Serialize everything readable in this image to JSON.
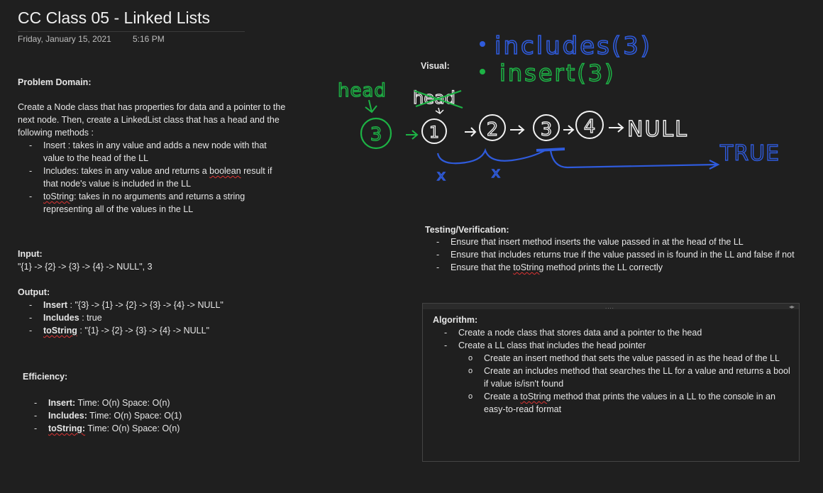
{
  "page": {
    "title": "CC Class 05 - Linked Lists",
    "date": "Friday, January 15, 2021",
    "time": "5:16 PM"
  },
  "problem_domain": {
    "heading": "Problem Domain:",
    "intro": "Create a Node class that has properties for data and a pointer to the next node. Then, create a LinkedList class that has a head and the following methods :",
    "items": [
      {
        "pre": "Insert : takes in any value and adds a new node with that value to the head of the LL"
      },
      {
        "pre": "Includes: takes in any value and returns a ",
        "u": "boolean",
        "post": " result if that node's value is included in the LL"
      },
      {
        "u": "toString",
        "post": ": takes in no arguments and returns a string representing all of the values in the LL"
      }
    ]
  },
  "input": {
    "heading": "Input:",
    "value": "\"{1} -> {2} -> {3} -> {4} -> NULL\", 3"
  },
  "output": {
    "heading": "Output:",
    "items": [
      {
        "label": "Insert",
        "sep": " : ",
        "value": "\"{3} -> {1} -> {2} -> {3} -> {4} -> NULL\""
      },
      {
        "label": "Includes",
        "sep": " : ",
        "value": "true"
      },
      {
        "label": "toString",
        "sep": " : ",
        "value": "\"{1} -> {2} -> {3} -> {4} -> NULL\""
      }
    ]
  },
  "efficiency": {
    "heading": "Efficiency:",
    "items": [
      {
        "label": "Insert:",
        "value": " Time: O(n) Space: O(n)"
      },
      {
        "label": "Includes:",
        "value": " Time: O(n) Space: O(1)"
      },
      {
        "label": "toString:",
        "value": " Time: O(n) Space: O(n)"
      }
    ]
  },
  "visual": {
    "heading": "Visual:",
    "handwriting": {
      "includes": "includes(3)",
      "insert": "insert(3)",
      "head_new": "head",
      "head_old": "head",
      "nodes": [
        "3",
        "1",
        "2",
        "3",
        "4"
      ],
      "null": "NULL",
      "true": "TRUE",
      "marks": [
        "x",
        "x"
      ]
    },
    "colors": {
      "ink_green": "#1db345",
      "ink_blue": "#2f5bdc",
      "ink_white": "#f2f2f2"
    }
  },
  "testing": {
    "heading": "Testing/Verification:",
    "items": [
      {
        "pre": "Ensure that insert method inserts the value passed in at the head of the LL"
      },
      {
        "pre": "Ensure that includes returns true if the value passed in is found in the LL and false if not"
      },
      {
        "pre": "Ensure that the ",
        "u": "toString",
        "post": " method prints the LL correctly"
      }
    ]
  },
  "algorithm": {
    "heading": "Algorithm:",
    "items": [
      {
        "pre": "Create a node class that stores data and a pointer to the head",
        "sub": []
      },
      {
        "pre": "Create a LL class that includes the head pointer",
        "sub": [
          {
            "pre": "Create an insert method that sets the value passed in as the head of the LL"
          },
          {
            "pre": "Create an includes method that searches the LL for a value and returns a bool if value is/isn't found"
          },
          {
            "pre": "Create a ",
            "u": "toString",
            "post": " method that prints the values in a LL to the console in an easy-to-read format"
          }
        ]
      }
    ],
    "grip": "....",
    "resize": "◂▸"
  }
}
